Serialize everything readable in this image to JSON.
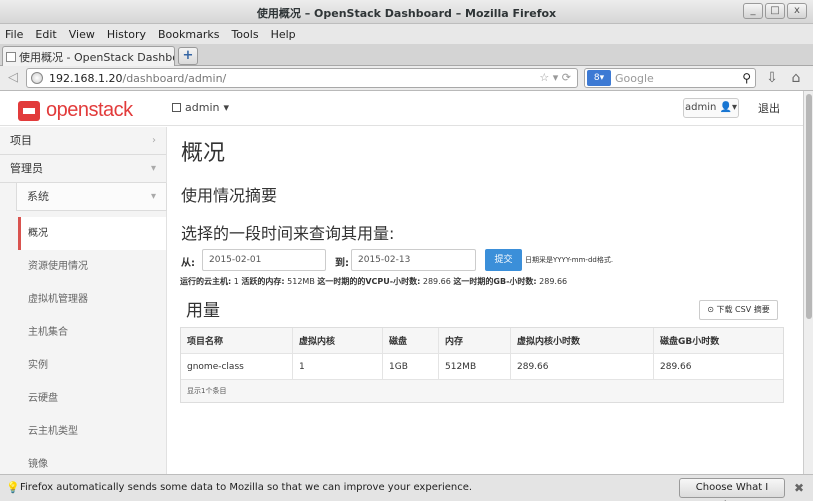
{
  "window": {
    "title": "使用概况 – OpenStack Dashboard – Mozilla Firefox",
    "controls": [
      "_",
      "□",
      "x"
    ]
  },
  "menubar": [
    "File",
    "Edit",
    "View",
    "History",
    "Bookmarks",
    "Tools",
    "Help"
  ],
  "tab": {
    "label": "使用概况 - OpenStack Dashboard",
    "new_tab": "+"
  },
  "navbar": {
    "url_host": "192.168.1.20",
    "url_path": "/dashboard/admin/",
    "search_placeholder": "Google",
    "search_engine": "8"
  },
  "header": {
    "logo_text": "openstack",
    "project": "admin",
    "user": "admin",
    "logout": "退出"
  },
  "sidebar": {
    "project": "项目",
    "admin": "管理员",
    "system": "系统",
    "items": [
      "概况",
      "资源使用情况",
      "虚拟机管理器",
      "主机集合",
      "实例",
      "云硬盘",
      "云主机类型",
      "镜像"
    ]
  },
  "main": {
    "title": "概况",
    "subtitle": "使用情况摘要",
    "query_title": "选择的一段时间来查询其用量:",
    "from_label": "从:",
    "from_value": "2015-02-01",
    "to_label": "到:",
    "to_value": "2015-02-13",
    "submit": "提交",
    "hint": "日期采是YYYY-mm-dd格式.",
    "summary": {
      "instances_label": "运行的云主机:",
      "instances": "1",
      "ram_label": "活跃的内存:",
      "ram": "512MB",
      "vcpu_label": "这一时期的的VCPU-小时数:",
      "vcpu": "289.66",
      "gb_label": "这一时期的GB-小时数:",
      "gb": "289.66"
    },
    "usage_title": "用量",
    "csv_button": "下载 CSV 摘要",
    "table": {
      "headers": [
        "项目名称",
        "虚拟内核",
        "磁盘",
        "内存",
        "虚拟内核小时数",
        "磁盘GB小时数"
      ],
      "rows": [
        [
          "gnome-class",
          "1",
          "1GB",
          "512MB",
          "289.66",
          "289.66"
        ]
      ],
      "footer": "显示1个条目"
    }
  },
  "notification": {
    "message": "Firefox automatically sends some data to Mozilla so that we can improve your experience.",
    "button": "Choose What I Share",
    "close": "✖"
  },
  "colors": {
    "accent": "#e23b3b",
    "primary_button": "#3b8fd9",
    "active_border": "#d9534f"
  }
}
